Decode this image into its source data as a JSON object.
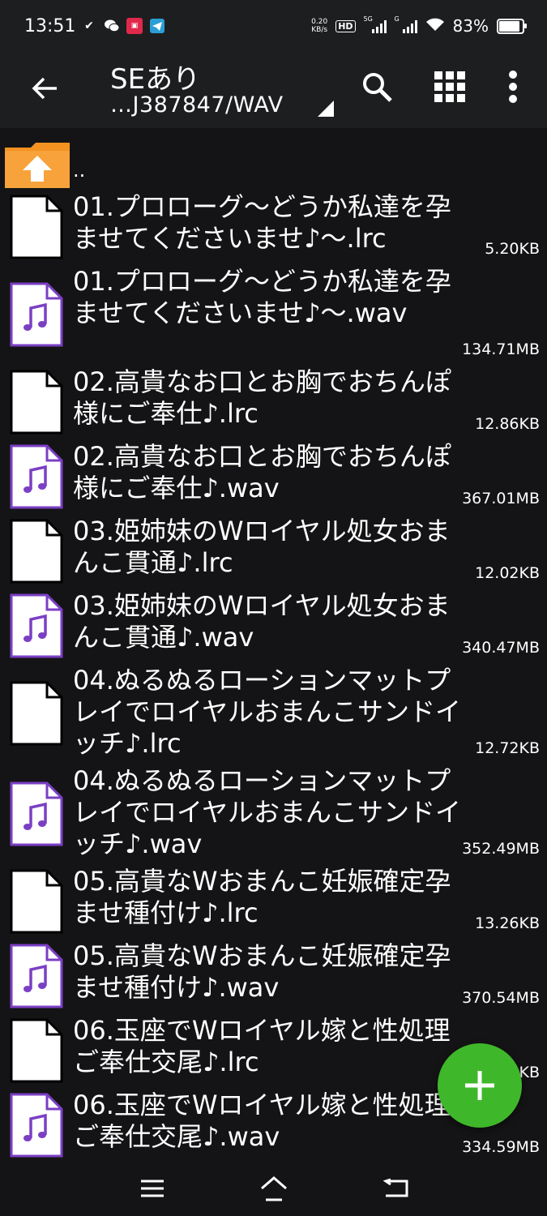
{
  "status_bar": {
    "time": "13:51",
    "net_speed_value": "0.20",
    "net_speed_unit": "KB/s",
    "hd_label": "HD",
    "signal1_label": "5G",
    "signal2_label": "G",
    "battery_percent": "83%",
    "battery_level": 0.83,
    "icons": [
      "check-icon",
      "wechat-icon",
      "notification-app-icon",
      "telegram-icon",
      "wifi-icon"
    ]
  },
  "app_bar": {
    "title": "SEあり",
    "path": "…J387847/WAV",
    "icons": [
      "back-arrow-icon",
      "search-icon",
      "grid-view-icon",
      "more-vert-icon"
    ]
  },
  "parent_dir_label": "..",
  "files": [
    {
      "name": "01.プロローグ～どうか私達を孕ませてくださいませ♪～.lrc",
      "size": "5.20KB",
      "type": "lrc"
    },
    {
      "name": "01.プロローグ～どうか私達を孕ませてくださいませ♪～.wav",
      "size": "134.71MB",
      "type": "wav"
    },
    {
      "name": "02.高貴なお口とお胸でおちんぽ様にご奉仕♪.lrc",
      "size": "12.86KB",
      "type": "lrc"
    },
    {
      "name": "02.高貴なお口とお胸でおちんぽ様にご奉仕♪.wav",
      "size": "367.01MB",
      "type": "wav"
    },
    {
      "name": "03.姫姉妹のWロイヤル処女おまんこ貫通♪.lrc",
      "size": "12.02KB",
      "type": "lrc"
    },
    {
      "name": "03.姫姉妹のWロイヤル処女おまんこ貫通♪.wav",
      "size": "340.47MB",
      "type": "wav"
    },
    {
      "name": "04.ぬるぬるローションマットプレイでロイヤルおまんこサンドイッチ♪.lrc",
      "size": "12.72KB",
      "type": "lrc"
    },
    {
      "name": "04.ぬるぬるローションマットプレイでロイヤルおまんこサンドイッチ♪.wav",
      "size": "352.49MB",
      "type": "wav"
    },
    {
      "name": "05.高貴なWおまんこ妊娠確定孕ませ種付け♪.lrc",
      "size": "13.26KB",
      "type": "lrc"
    },
    {
      "name": "05.高貴なWおまんこ妊娠確定孕ませ種付け♪.wav",
      "size": "370.54MB",
      "type": "wav"
    },
    {
      "name": "06.玉座でWロイヤル嫁と性処理ご奉仕交尾♪.lrc",
      "size": "KB",
      "type": "lrc"
    },
    {
      "name": "06.玉座でWロイヤル嫁と性処理ご奉仕交尾♪.wav",
      "size": "334.59MB",
      "type": "wav"
    }
  ],
  "fab_icon": "add-icon",
  "nav_icons": [
    "menu-icon",
    "home-icon",
    "back-icon"
  ],
  "colors": {
    "background": "#141416",
    "app_bar": "#1d1e20",
    "fab": "#3fb72a",
    "folder": "#f39221",
    "audio_icon": "#7b3fc4"
  }
}
